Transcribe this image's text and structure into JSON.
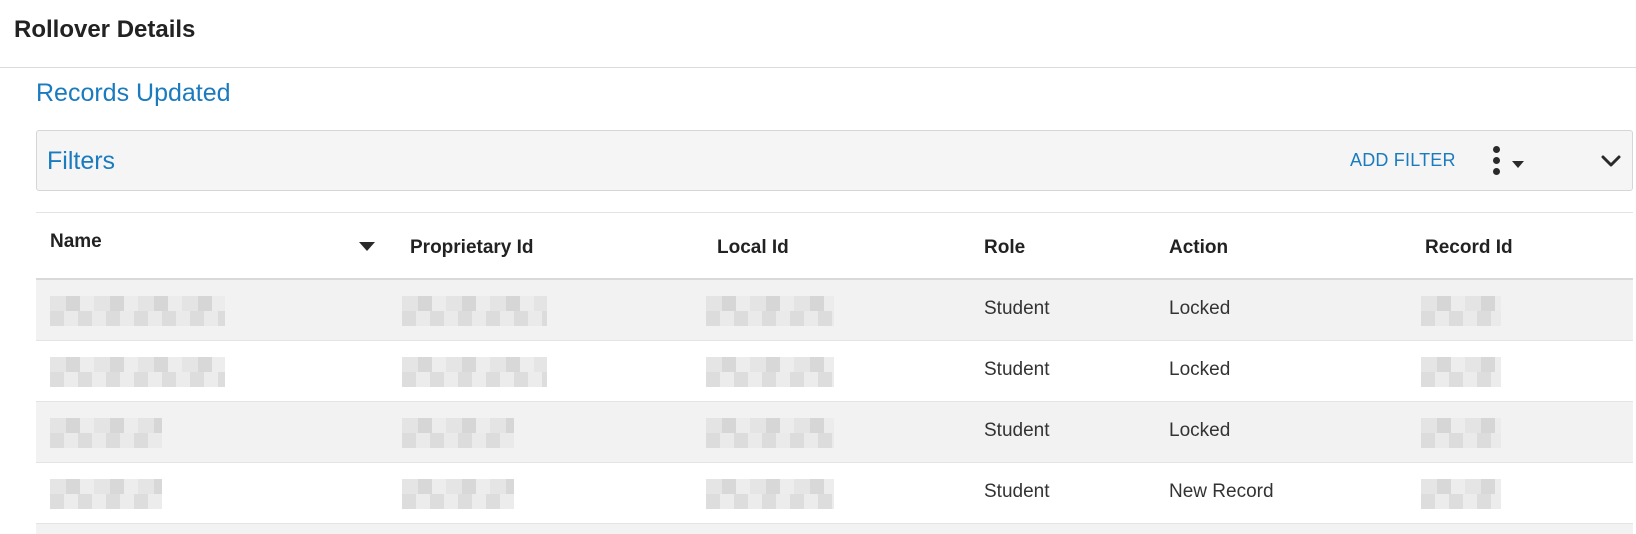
{
  "header": {
    "title": "Rollover Details"
  },
  "section": {
    "title": "Records Updated"
  },
  "filters": {
    "label": "Filters",
    "add_filter_label": "ADD FILTER",
    "icons": {
      "menu": "kebab-menu-icon",
      "caret": "caret-down-icon",
      "collapse": "chevron-down-icon"
    }
  },
  "table": {
    "columns": {
      "name": "Name",
      "proprietary_id": "Proprietary Id",
      "local_id": "Local Id",
      "role": "Role",
      "action": "Action",
      "record_id": "Record Id"
    },
    "rows": [
      {
        "role": "Student",
        "action": "Locked"
      },
      {
        "role": "Student",
        "action": "Locked"
      },
      {
        "role": "Student",
        "action": "Locked"
      },
      {
        "role": "Student",
        "action": "New Record"
      }
    ]
  },
  "colors": {
    "accent": "#1a7bbf",
    "filters_bg": "#f5f5f5",
    "row_alt": "#f2f2f2"
  }
}
